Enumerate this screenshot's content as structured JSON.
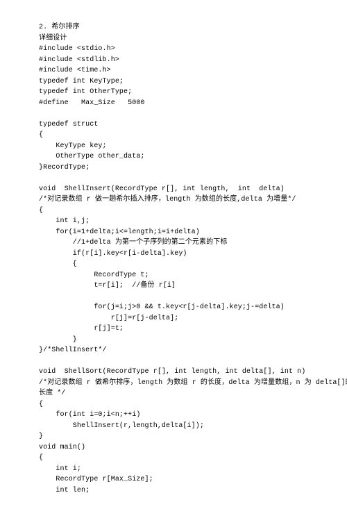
{
  "lines": [
    "2. 希尔排序",
    "详细设计",
    "#include <stdio.h>",
    "#include <stdlib.h>",
    "#include <time.h>",
    "typedef int KeyType;",
    "typedef int OtherType;",
    "#define   Max_Size   5000",
    "",
    "typedef struct",
    "{",
    "    KeyType key;",
    "    OtherType other_data;",
    "}RecordType;",
    "",
    "void  ShellInsert(RecordType r[], int length,  int  delta)",
    "/*对记录数组 r 做一趟希尔插入排序，length 为数组的长度,delta 为增量*/",
    "{",
    "    int i,j;",
    "    for(i=1+delta;i<=length;i=i+delta)",
    "        //1+delta 为第一个子序列的第二个元素的下标",
    "        if(r[i].key<r[i-delta].key)",
    "        {",
    "             RecordType t;",
    "             t=r[i];  //备份 r[i]",
    "",
    "             for(j=i;j>0 && t.key<r[j-delta].key;j-=delta)",
    "                 r[j]=r[j-delta];",
    "             r[j]=t;",
    "        }",
    "}/*ShellInsert*/",
    "",
    "void  ShellSort(RecordType r[], int length, int delta[], int n)",
    "/*对记录数组 r 做希尔排序，length 为数组 r 的长度，delta 为增量数组，n 为 delta[]的",
    "长度 */",
    "{",
    "    for(int i=0;i<n;++i)",
    "        ShellInsert(r,length,delta[i]);",
    "}",
    "void main()",
    "{",
    "    int i;",
    "    RecordType r[Max_Size];",
    "    int len;"
  ]
}
